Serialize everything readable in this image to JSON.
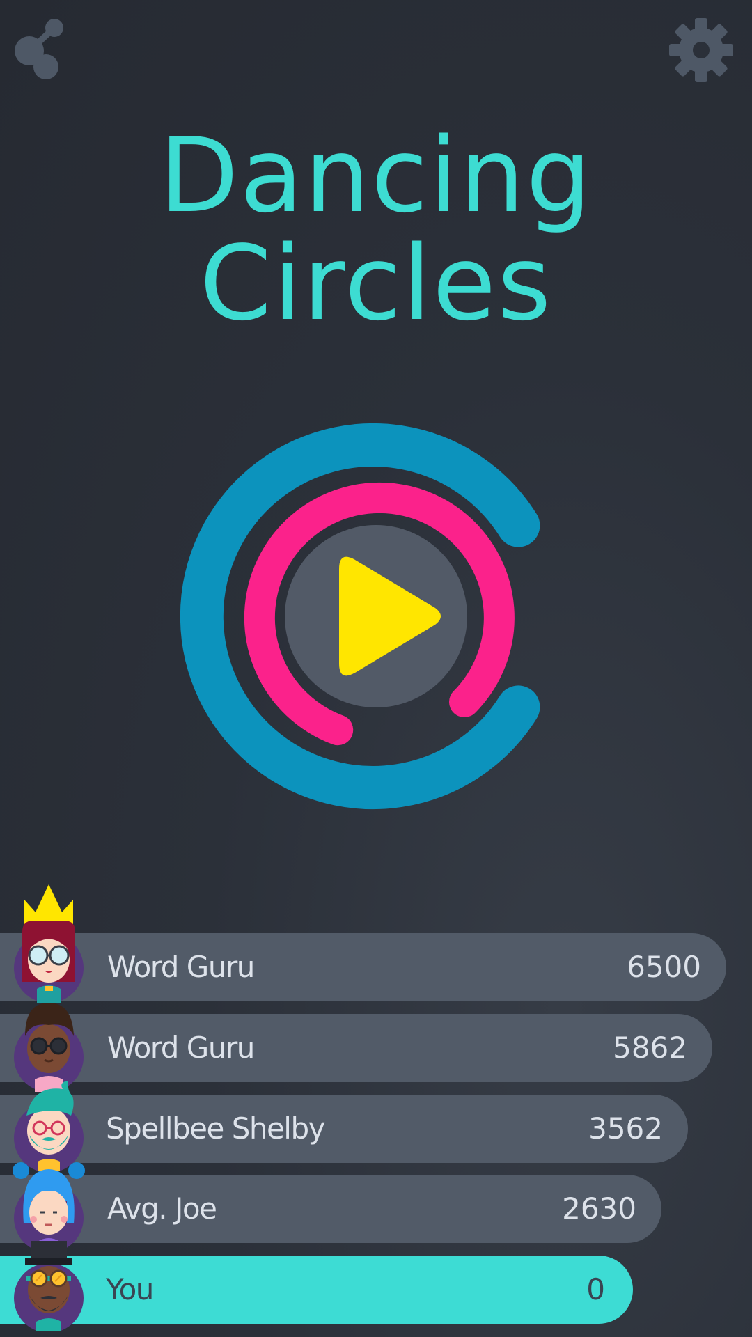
{
  "header": {
    "share_icon": "share-icon",
    "settings_icon": "gear-icon"
  },
  "title": {
    "line1": "Dancing",
    "line2": "Circles"
  },
  "play_button": {
    "icon": "play-icon",
    "colors": {
      "outer_ring": "#0c93bd",
      "inner_ring": "#fb228b",
      "center": "#525a67",
      "play": "#ffe600"
    }
  },
  "leaderboard": {
    "entries": [
      {
        "name": "Word Guru",
        "score": "6500",
        "avatar": "girl-red-hair-glasses-crown"
      },
      {
        "name": "Word Guru",
        "score": "5862",
        "avatar": "boy-dark-hair-glasses"
      },
      {
        "name": "Spellbee Shelby",
        "score": "3562",
        "avatar": "teal-hair-beard-glasses"
      },
      {
        "name": "Avg. Joe",
        "score": "2630",
        "avatar": "girl-blue-hair-buns"
      },
      {
        "name": "You",
        "score": "0",
        "avatar": "top-hat-goggles-beard"
      }
    ],
    "colors": {
      "row": "#525b68",
      "you_row": "#3ddcd4",
      "accent": "#3ddcd2"
    }
  }
}
